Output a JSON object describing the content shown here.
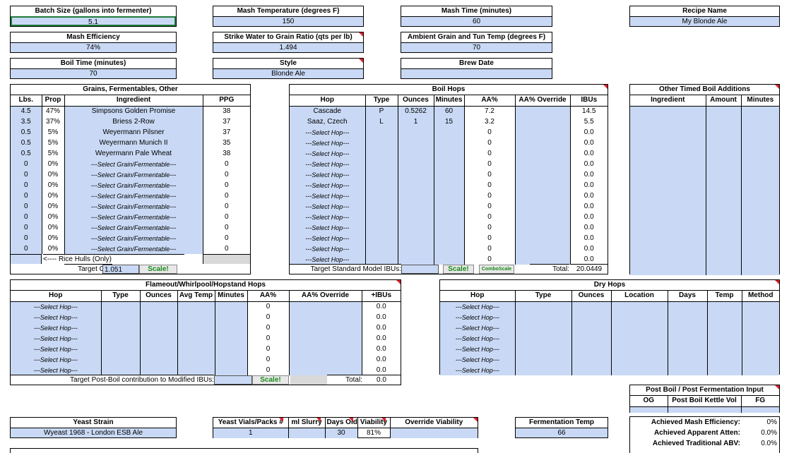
{
  "fields": {
    "batch_size": {
      "label": "Batch Size (gallons into fermenter)",
      "value": "5.1"
    },
    "mash_temp": {
      "label": "Mash Temperature (degrees F)",
      "value": "150"
    },
    "mash_time": {
      "label": "Mash Time (minutes)",
      "value": "60"
    },
    "recipe_name": {
      "label": "Recipe Name",
      "value": "My Blonde Ale"
    },
    "mash_efficiency": {
      "label": "Mash Efficiency",
      "value": "74%"
    },
    "strike_ratio": {
      "label": "Strike Water to Grain Ratio (qts per lb)",
      "value": "1.494"
    },
    "ambient_temp": {
      "label": "Ambient Grain and Tun Temp (degrees F)",
      "value": "70"
    },
    "boil_time": {
      "label": "Boil Time (minutes)",
      "value": "70"
    },
    "style": {
      "label": "Style",
      "value": "Blonde Ale"
    },
    "brew_date": {
      "label": "Brew Date",
      "value": ""
    }
  },
  "grains": {
    "title": "Grains, Fermentables, Other",
    "headers": [
      "Lbs.",
      "Prop",
      "Ingredient",
      "PPG"
    ],
    "rows": [
      [
        "4.5",
        "47%",
        "Simpsons Golden Promise",
        "38"
      ],
      [
        "3.5",
        "37%",
        "Briess 2-Row",
        "37"
      ],
      [
        "0.5",
        "5%",
        "Weyermann Pilsner",
        "37"
      ],
      [
        "0.5",
        "5%",
        "Weyermann Munich II",
        "35"
      ],
      [
        "0.5",
        "5%",
        "Weyermann Pale Wheat",
        "38"
      ],
      [
        "0",
        "0%",
        "---Select Grain/Fermentable---",
        "0"
      ],
      [
        "0",
        "0%",
        "---Select Grain/Fermentable---",
        "0"
      ],
      [
        "0",
        "0%",
        "---Select Grain/Fermentable---",
        "0"
      ],
      [
        "0",
        "0%",
        "---Select Grain/Fermentable---",
        "0"
      ],
      [
        "0",
        "0%",
        "---Select Grain/Fermentable---",
        "0"
      ],
      [
        "0",
        "0%",
        "---Select Grain/Fermentable---",
        "0"
      ],
      [
        "0",
        "0%",
        "---Select Grain/Fermentable---",
        "0"
      ],
      [
        "0",
        "0%",
        "---Select Grain/Fermentable---",
        "0"
      ],
      [
        "0",
        "0%",
        "---Select Grain/Fermentable---",
        "0"
      ]
    ],
    "rice_hulls": "<---- Rice Hulls (Only)",
    "target_og_label": "Target OG:",
    "target_og": "1.051",
    "scale_label": "Scale!"
  },
  "boil_hops": {
    "title": "Boil Hops",
    "headers": [
      "Hop",
      "Type",
      "Ounces",
      "Minutes",
      "AA%",
      "AA% Override",
      "IBUs"
    ],
    "rows": [
      [
        "Cascade",
        "P",
        "0.5262",
        "60",
        "7.2",
        "",
        "14.5"
      ],
      [
        "Saaz, Czech",
        "L",
        "1",
        "15",
        "3.2",
        "",
        "5.5"
      ],
      [
        "---Select Hop---",
        "",
        "",
        "",
        "0",
        "",
        "0.0"
      ],
      [
        "---Select Hop---",
        "",
        "",
        "",
        "0",
        "",
        "0.0"
      ],
      [
        "---Select Hop---",
        "",
        "",
        "",
        "0",
        "",
        "0.0"
      ],
      [
        "---Select Hop---",
        "",
        "",
        "",
        "0",
        "",
        "0.0"
      ],
      [
        "---Select Hop---",
        "",
        "",
        "",
        "0",
        "",
        "0.0"
      ],
      [
        "---Select Hop---",
        "",
        "",
        "",
        "0",
        "",
        "0.0"
      ],
      [
        "---Select Hop---",
        "",
        "",
        "",
        "0",
        "",
        "0.0"
      ],
      [
        "---Select Hop---",
        "",
        "",
        "",
        "0",
        "",
        "0.0"
      ],
      [
        "---Select Hop---",
        "",
        "",
        "",
        "0",
        "",
        "0.0"
      ],
      [
        "---Select Hop---",
        "",
        "",
        "",
        "0",
        "",
        "0.0"
      ],
      [
        "---Select Hop---",
        "",
        "",
        "",
        "0",
        "",
        "0.0"
      ],
      [
        "---Select Hop---",
        "",
        "",
        "",
        "0",
        "",
        "0.0"
      ],
      [
        "---Select Hop---",
        "",
        "",
        "",
        "0",
        "",
        "0.0"
      ]
    ],
    "target_label": "Target Standard Model IBUs:",
    "scale_label": "Scale!",
    "comboscale_label": "ComboScale",
    "total_label": "Total:",
    "total": "20.0449"
  },
  "other_additions": {
    "title": "Other Timed Boil Additions",
    "headers": [
      "Ingredient",
      "Amount",
      "Minutes"
    ]
  },
  "flameout": {
    "title": "Flameout/Whirlpool/Hopstand Hops",
    "headers": [
      "Hop",
      "Type",
      "Ounces",
      "Avg Temp",
      "Minutes",
      "AA%",
      "AA% Override",
      "+IBUs"
    ],
    "rows": [
      [
        "---Select Hop---",
        "",
        "",
        "",
        "",
        "0",
        "",
        "0.0"
      ],
      [
        "---Select Hop---",
        "",
        "",
        "",
        "",
        "0",
        "",
        "0.0"
      ],
      [
        "---Select Hop---",
        "",
        "",
        "",
        "",
        "0",
        "",
        "0.0"
      ],
      [
        "---Select Hop---",
        "",
        "",
        "",
        "",
        "0",
        "",
        "0.0"
      ],
      [
        "---Select Hop---",
        "",
        "",
        "",
        "",
        "0",
        "",
        "0.0"
      ],
      [
        "---Select Hop---",
        "",
        "",
        "",
        "",
        "0",
        "",
        "0.0"
      ],
      [
        "---Select Hop---",
        "",
        "",
        "",
        "",
        "0",
        "",
        "0.0"
      ]
    ],
    "target_label": "Target Post-Boil contribution to Modified IBUs:",
    "scale_label": "Scale!",
    "total_label": "Total:",
    "total": "0.0"
  },
  "dry_hops": {
    "title": "Dry Hops",
    "headers": [
      "Hop",
      "Type",
      "Ounces",
      "Location",
      "Days",
      "Temp",
      "Method"
    ],
    "rows": [
      "---Select Hop---",
      "---Select Hop---",
      "---Select Hop---",
      "---Select Hop---",
      "---Select Hop---",
      "---Select Hop---",
      "---Select Hop---"
    ]
  },
  "post_boil": {
    "title": "Post Boil / Post Fermentation Input",
    "headers": [
      "OG",
      "Post Boil Kettle Vol",
      "FG"
    ],
    "achieved": [
      {
        "label": "Achieved Mash Efficiency:",
        "value": "0%"
      },
      {
        "label": "Achieved Apparent Atten:",
        "value": "0.0%"
      },
      {
        "label": "Achieved Traditional ABV:",
        "value": "0.0%"
      }
    ]
  },
  "yeast": {
    "strain_label": "Yeast Strain",
    "strain": "Wyeast 1968 - London ESB Ale",
    "headers": [
      "Yeast Vials/Packs #",
      "ml Slurry",
      "Days Old",
      "Viability",
      "Override Viability"
    ],
    "values": [
      "1",
      "",
      "30",
      "81%",
      ""
    ]
  },
  "fermentation": {
    "label": "Fermentation Temp",
    "value": "66"
  }
}
